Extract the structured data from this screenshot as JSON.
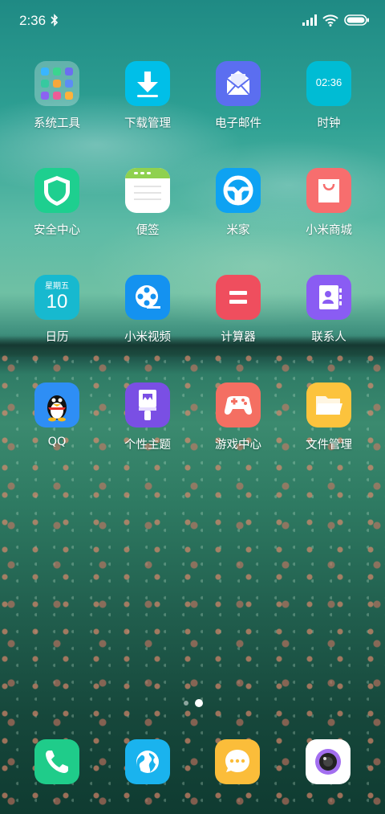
{
  "status_bar": {
    "time": "2:36",
    "icons": [
      "bluetooth-icon",
      "signal-icon",
      "wifi-icon",
      "battery-icon"
    ]
  },
  "home": {
    "apps": [
      {
        "label": "系统工具",
        "icon": "folder-icon"
      },
      {
        "label": "下载管理",
        "icon": "download-icon"
      },
      {
        "label": "电子邮件",
        "icon": "mail-icon"
      },
      {
        "label": "时钟",
        "icon": "clock-icon",
        "clock_text": "02:36"
      },
      {
        "label": "安全中心",
        "icon": "shield-icon"
      },
      {
        "label": "便签",
        "icon": "notes-icon"
      },
      {
        "label": "米家",
        "icon": "steering-wheel-icon"
      },
      {
        "label": "小米商城",
        "icon": "shopping-bag-icon"
      },
      {
        "label": "日历",
        "icon": "calendar-icon",
        "weekday": "星期五",
        "day": "10"
      },
      {
        "label": "小米视频",
        "icon": "film-reel-icon"
      },
      {
        "label": "计算器",
        "icon": "equals-icon"
      },
      {
        "label": "联系人",
        "icon": "contacts-icon"
      },
      {
        "label": "QQ",
        "icon": "penguin-icon"
      },
      {
        "label": "个性主题",
        "icon": "paint-brush-icon"
      },
      {
        "label": "游戏中心",
        "icon": "gamepad-icon"
      },
      {
        "label": "文件管理",
        "icon": "file-folder-icon"
      }
    ],
    "page_indicator": {
      "pages": 2,
      "current": 2
    }
  },
  "dock": [
    {
      "name": "phone",
      "icon": "phone-icon"
    },
    {
      "name": "browser",
      "icon": "globe-icon"
    },
    {
      "name": "messages",
      "icon": "chat-bubble-icon"
    },
    {
      "name": "camera",
      "icon": "camera-lens-icon"
    }
  ],
  "colors": {
    "download": "#00bfe8",
    "mail": "#5b6ef0",
    "clock": "#00bcd4",
    "security": "#1ecf8f",
    "mijia": "#0ea2f2",
    "shop": "#f76e6e",
    "calendar": "#17b9cf",
    "video": "#1492f0",
    "calculator": "#ef4e5e",
    "contacts": "#8a5cf3",
    "qq": "#2e8ef5",
    "themes": "#7a4fe4",
    "game": "#f46f62",
    "files": "#fcc33d",
    "phone": "#1fcc8a",
    "browser": "#1ab3ee",
    "messages": "#fbbd3a",
    "camera": "#ffffff"
  }
}
